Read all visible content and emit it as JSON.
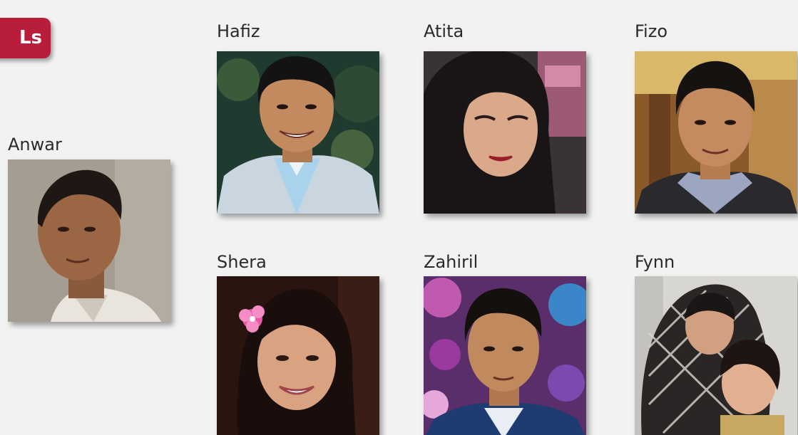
{
  "section_badge": {
    "label": "Ls",
    "color": "#b81e3c"
  },
  "people": [
    {
      "id": "anwar",
      "name": "Anwar"
    },
    {
      "id": "hafiz",
      "name": "Hafiz"
    },
    {
      "id": "atita",
      "name": "Atita"
    },
    {
      "id": "fizo",
      "name": "Fizo"
    },
    {
      "id": "shera",
      "name": "Shera"
    },
    {
      "id": "zahiril",
      "name": "Zahiril"
    },
    {
      "id": "fynn",
      "name": "Fynn"
    }
  ]
}
